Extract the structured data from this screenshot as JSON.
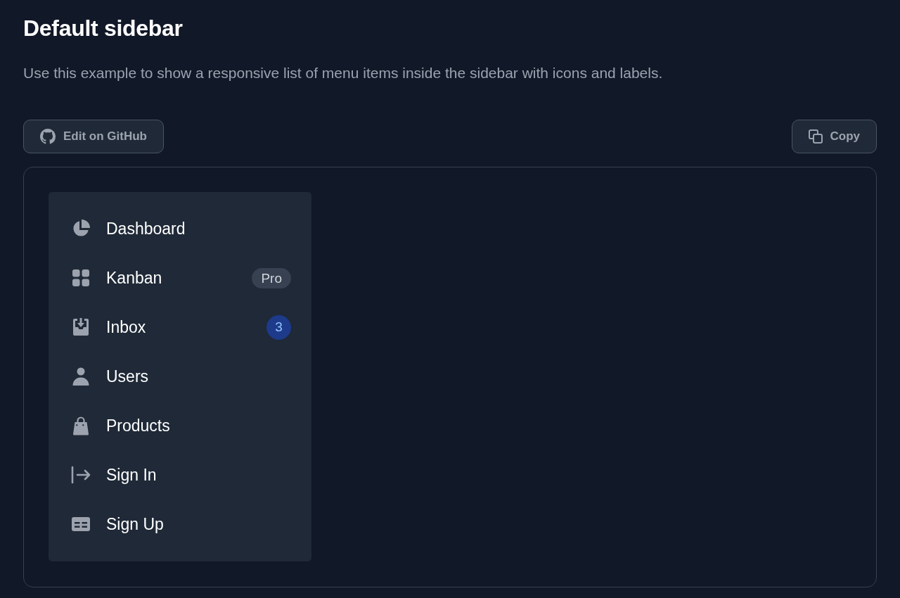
{
  "page": {
    "title": "Default sidebar",
    "description": "Use this example to show a responsive list of menu items inside the sidebar with icons and labels."
  },
  "toolbar": [
    {
      "label": "Edit on GitHub"
    },
    {
      "label": "Copy"
    }
  ],
  "sidebar": {
    "items": [
      {
        "label": "Dashboard"
      },
      {
        "label": "Kanban",
        "badge": {
          "text": "Pro",
          "kind": "tag"
        }
      },
      {
        "label": "Inbox",
        "badge": {
          "text": "3",
          "kind": "count"
        }
      },
      {
        "label": "Users"
      },
      {
        "label": "Products"
      },
      {
        "label": "Sign In"
      },
      {
        "label": "Sign Up"
      }
    ]
  }
}
